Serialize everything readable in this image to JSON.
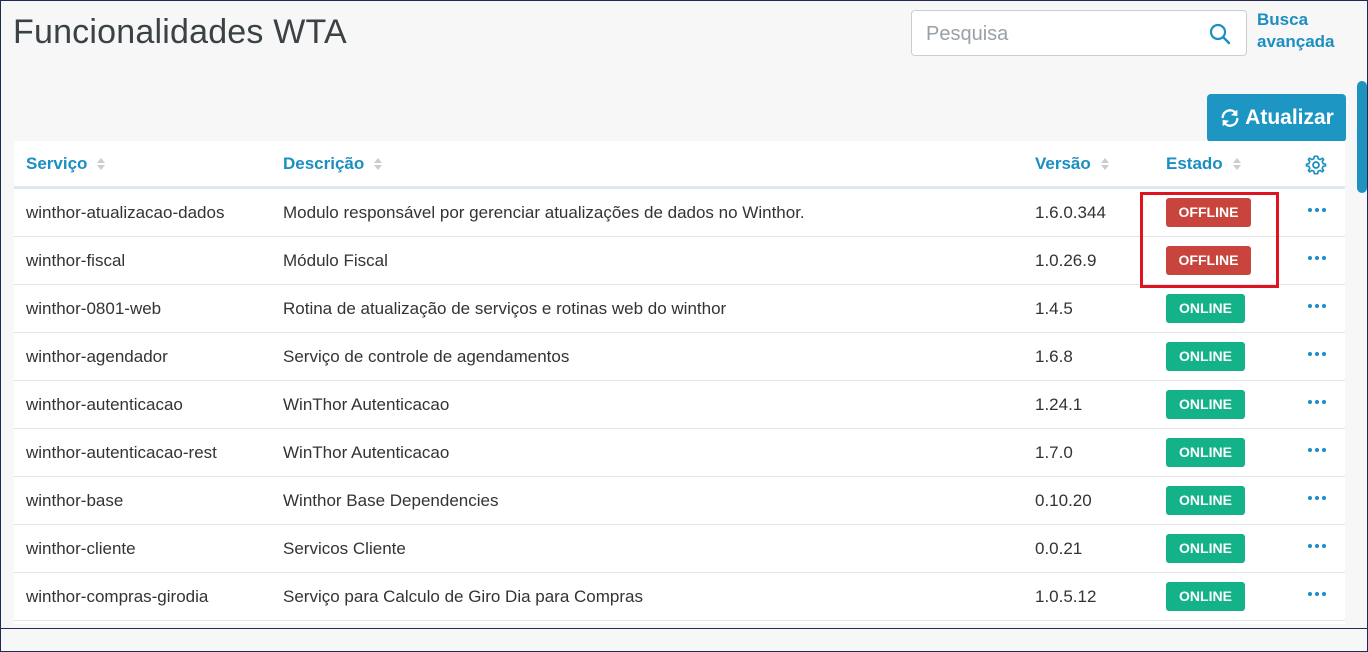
{
  "header": {
    "title": "Funcionalidades WTA"
  },
  "search": {
    "placeholder": "Pesquisa",
    "advanced_line1": "Busca",
    "advanced_line2": "avançada"
  },
  "toolbar": {
    "refresh_label": "Atualizar"
  },
  "table": {
    "columns": [
      "Serviço",
      "Descrição",
      "Versão",
      "Estado"
    ],
    "rows": [
      {
        "service": "winthor-atualizacao-dados",
        "description": "Modulo responsável por gerenciar atualizações de dados no Winthor.",
        "version": "1.6.0.344",
        "status": "OFFLINE"
      },
      {
        "service": "winthor-fiscal",
        "description": "Módulo Fiscal",
        "version": "1.0.26.9",
        "status": "OFFLINE"
      },
      {
        "service": "winthor-0801-web",
        "description": "Rotina de atualização de serviços e rotinas web do winthor",
        "version": "1.4.5",
        "status": "ONLINE"
      },
      {
        "service": "winthor-agendador",
        "description": "Serviço de controle de agendamentos",
        "version": "1.6.8",
        "status": "ONLINE"
      },
      {
        "service": "winthor-autenticacao",
        "description": "WinThor Autenticacao",
        "version": "1.24.1",
        "status": "ONLINE"
      },
      {
        "service": "winthor-autenticacao-rest",
        "description": "WinThor Autenticacao",
        "version": "1.7.0",
        "status": "ONLINE"
      },
      {
        "service": "winthor-base",
        "description": "Winthor Base Dependencies",
        "version": "0.10.20",
        "status": "ONLINE"
      },
      {
        "service": "winthor-cliente",
        "description": "Servicos Cliente",
        "version": "0.0.21",
        "status": "ONLINE"
      },
      {
        "service": "winthor-compras-girodia",
        "description": "Serviço para Calculo de Giro Dia para Compras",
        "version": "1.0.5.12",
        "status": "ONLINE"
      }
    ]
  },
  "colors": {
    "accent": "#1d96c4",
    "offline": "#c9443d",
    "online": "#14b289",
    "highlight": "#e0141e"
  }
}
